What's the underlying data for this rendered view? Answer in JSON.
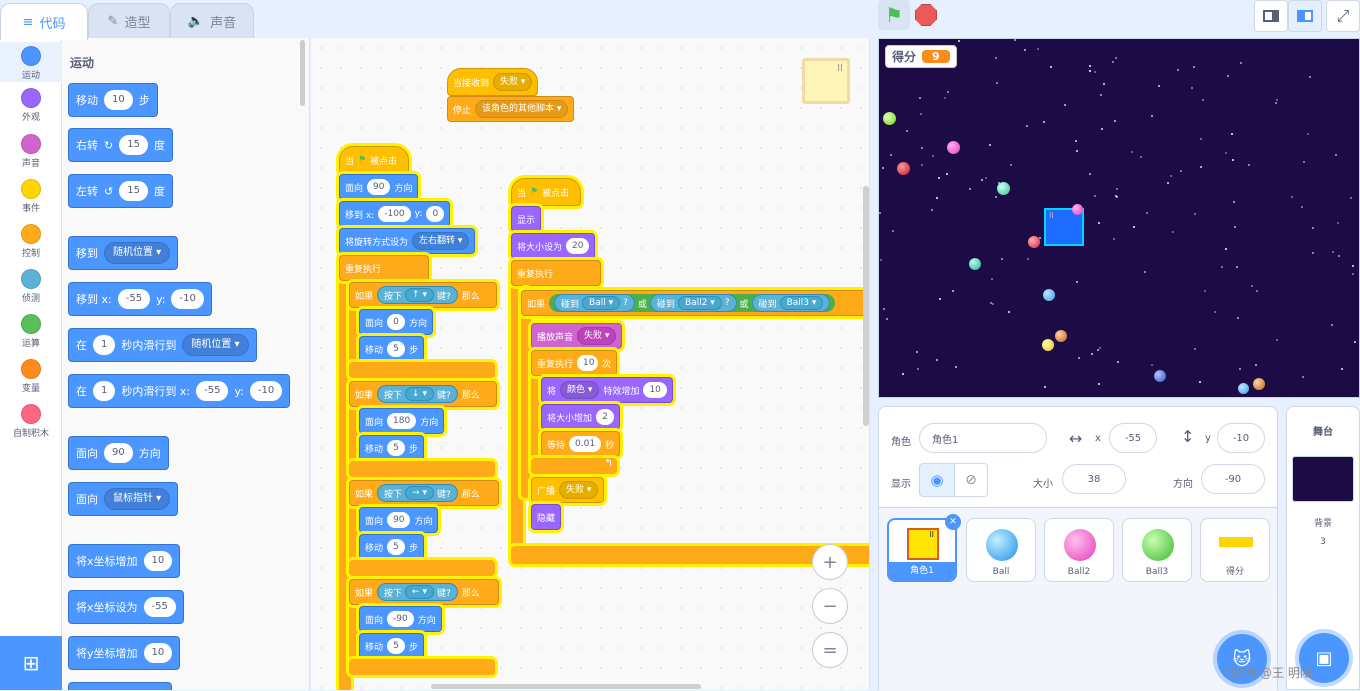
{
  "tabs": [
    {
      "label": "代码"
    },
    {
      "label": "造型"
    },
    {
      "label": "声音"
    }
  ],
  "categories": [
    {
      "label": "运动",
      "color": "#4c97ff"
    },
    {
      "label": "外观",
      "color": "#9966ff"
    },
    {
      "label": "声音",
      "color": "#cf63cf"
    },
    {
      "label": "事件",
      "color": "#ffd500"
    },
    {
      "label": "控制",
      "color": "#ffab19"
    },
    {
      "label": "侦测",
      "color": "#5cb1d6"
    },
    {
      "label": "运算",
      "color": "#59c059"
    },
    {
      "label": "变量",
      "color": "#ff8c1a"
    },
    {
      "label": "自制积木",
      "color": "#ff6680"
    }
  ],
  "palette": {
    "title": "运动",
    "move": {
      "a": "移动",
      "v": "10",
      "b": "步"
    },
    "turn_right": {
      "a": "右转",
      "v": "15",
      "b": "度"
    },
    "turn_left": {
      "a": "左转",
      "v": "15",
      "b": "度"
    },
    "goto": {
      "a": "移到",
      "dd": "随机位置"
    },
    "goto_xy": {
      "a": "移到 x:",
      "x": "-55",
      "b": "y:",
      "y": "-10"
    },
    "glide": {
      "a": "在",
      "v": "1",
      "b": "秒内滑行到",
      "dd": "随机位置"
    },
    "glide_xy": {
      "a": "在",
      "v": "1",
      "b": "秒内滑行到 x:",
      "x": "-55",
      "c": "y:",
      "y": "-10"
    },
    "point": {
      "a": "面向",
      "v": "90",
      "b": "方向"
    },
    "point_towards": {
      "a": "面向",
      "dd": "鼠标指针"
    },
    "change_x": {
      "a": "将x坐标增加",
      "v": "10"
    },
    "set_x": {
      "a": "将x坐标设为",
      "v": "-55"
    },
    "change_y": {
      "a": "将y坐标增加",
      "v": "10"
    }
  },
  "scripts": {
    "s1": {
      "hat": "当接收到",
      "dd": "失败",
      "stop": "停止",
      "stop_dd": "该角色的其他脚本"
    },
    "s2": {
      "hat": "当",
      "hat2": "被点击",
      "point": {
        "a": "面向",
        "v": "90",
        "b": "方向"
      },
      "goto": {
        "a": "移到 x:",
        "x": "-100",
        "b": "y:",
        "y": "0"
      },
      "rot": {
        "a": "将旋转方式设为",
        "dd": "左右翻转"
      },
      "forever": "重复执行",
      "ifs": [
        {
          "if": "如果",
          "key_a": "按下",
          "key": "↑",
          "key_b": "键?",
          "then": "那么",
          "face": "面向",
          "dir": "0",
          "dir_b": "方向",
          "move": "移动",
          "steps": "5",
          "steps_b": "步"
        },
        {
          "if": "如果",
          "key_a": "按下",
          "key": "↓",
          "key_b": "键?",
          "then": "那么",
          "face": "面向",
          "dir": "180",
          "dir_b": "方向",
          "move": "移动",
          "steps": "5",
          "steps_b": "步"
        },
        {
          "if": "如果",
          "key_a": "按下",
          "key": "→",
          "key_b": "键?",
          "then": "那么",
          "face": "面向",
          "dir": "90",
          "dir_b": "方向",
          "move": "移动",
          "steps": "5",
          "steps_b": "步"
        },
        {
          "if": "如果",
          "key_a": "按下",
          "key": "←",
          "key_b": "键?",
          "then": "那么",
          "face": "面向",
          "dir": "-90",
          "dir_b": "方向",
          "move": "移动",
          "steps": "5",
          "steps_b": "步"
        }
      ]
    },
    "s3": {
      "hat": "当",
      "hat2": "被点击",
      "show": "显示",
      "size": {
        "a": "将大小设为",
        "v": "20"
      },
      "forever": "重复执行",
      "if": "如果",
      "touch": "碰到",
      "b1": "Ball",
      "q": "?",
      "or": "或",
      "b2": "Ball2",
      "b3": "Ball3",
      "sound": {
        "a": "播放声音",
        "dd": "失败"
      },
      "repeat": {
        "a": "重复执行",
        "v": "10",
        "b": "次"
      },
      "effect": {
        "a": "将",
        "dd": "颜色",
        "b": "特效增加",
        "v": "10"
      },
      "chsize": {
        "a": "将大小增加",
        "v": "2"
      },
      "wait": {
        "a": "等待",
        "v": "0.01",
        "b": "秒"
      },
      "broadcast": {
        "a": "广播",
        "dd": "失败"
      },
      "hide": "隐藏"
    }
  },
  "zoom": {
    "in": "+",
    "out": "−",
    "reset": "="
  },
  "stage": {
    "score_label": "得分",
    "score_value": "9"
  },
  "sprite_info": {
    "sprite_label": "角色",
    "sprite_name": "角色1",
    "x_label": "x",
    "x": "-55",
    "y_label": "y",
    "y": "-10",
    "show_label": "显示",
    "size_label": "大小",
    "size": "38",
    "dir_label": "方向",
    "dir": "-90"
  },
  "sprites": [
    {
      "name": "角色1",
      "selected": true
    },
    {
      "name": "Ball",
      "color": "#1e8fe8"
    },
    {
      "name": "Ball2",
      "color": "#e63cb8"
    },
    {
      "name": "Ball3",
      "color": "#3cb82c"
    },
    {
      "name": "得分",
      "color": "#ffd500"
    }
  ],
  "stage_pane": {
    "title": "舞台",
    "bg_label": "背景",
    "bg_count": "3"
  },
  "watermark": "CSDN @王 明阳i",
  "colors": {
    "accent": "#4c97ff",
    "stage_bg": "#1d0b45"
  }
}
